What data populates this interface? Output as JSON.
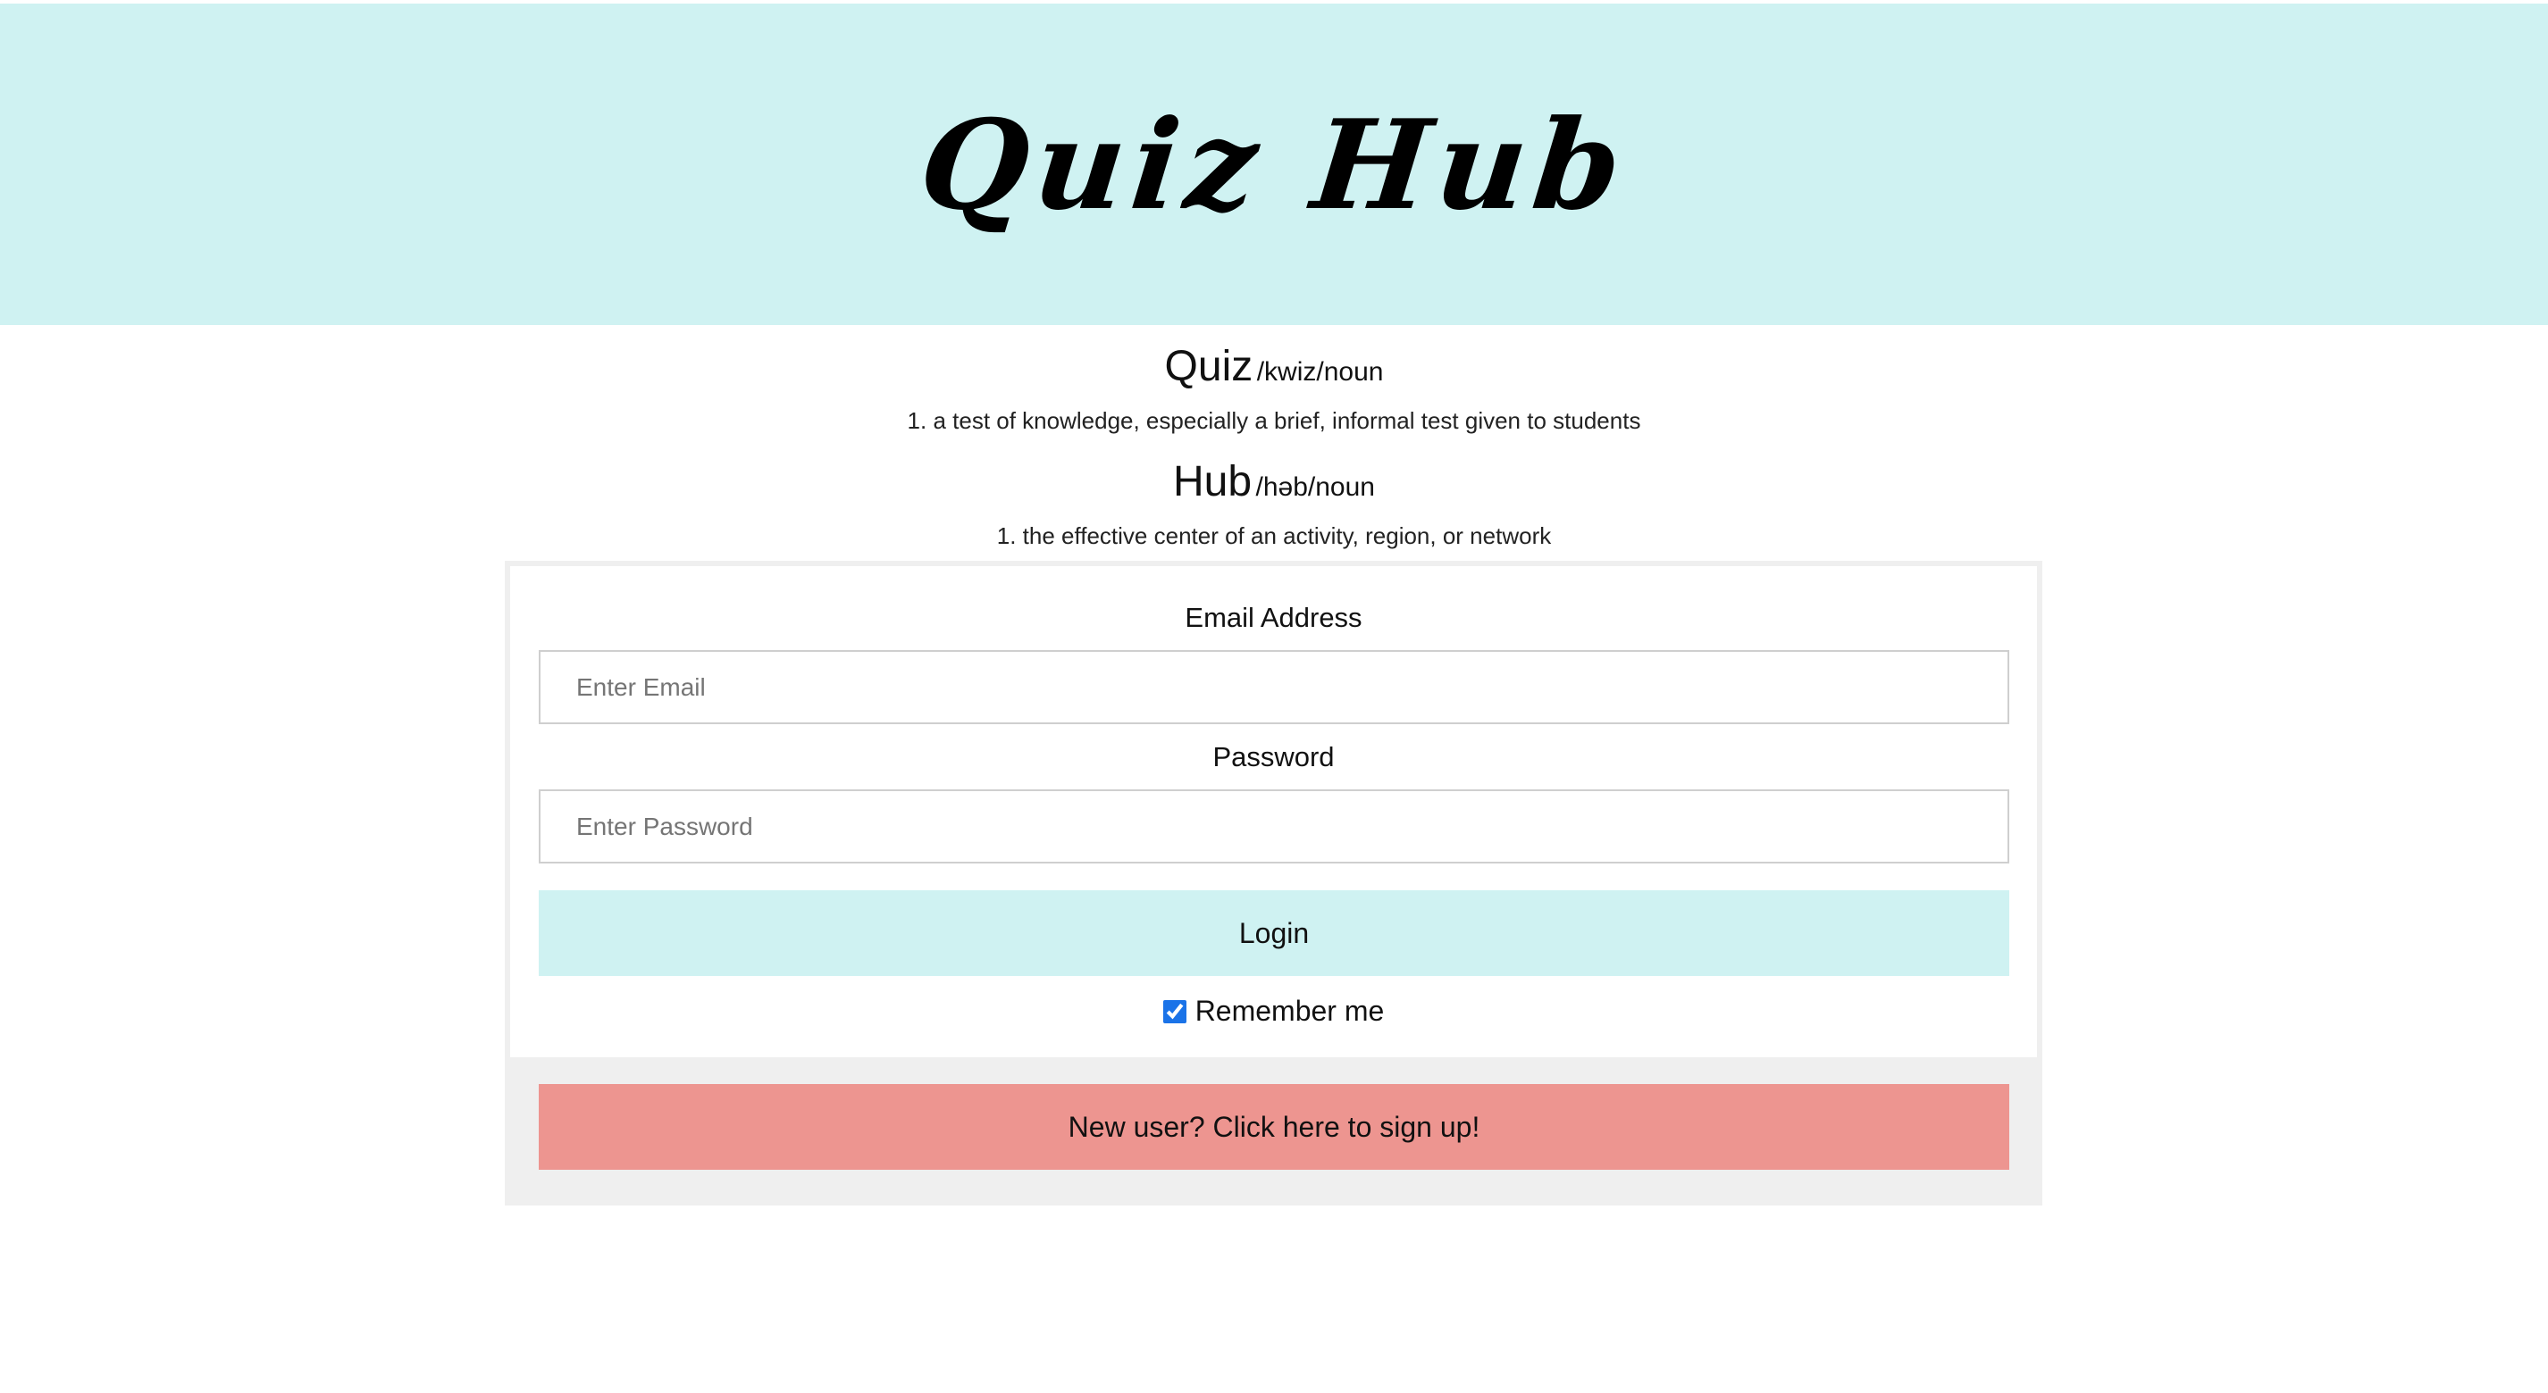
{
  "header": {
    "title": "Quiz Hub"
  },
  "definitions": [
    {
      "word": "Quiz",
      "pronunciation": "/kwiz/noun",
      "meaning": "1. a test of knowledge, especially a brief, informal test given to students"
    },
    {
      "word": "Hub",
      "pronunciation": "/həb/noun",
      "meaning": "1. the effective center of an activity, region, or network"
    }
  ],
  "login_form": {
    "email_label": "Email Address",
    "email_placeholder": "Enter Email",
    "email_value": "",
    "password_label": "Password",
    "password_placeholder": "Enter Password",
    "password_value": "",
    "login_button": "Login",
    "remember_me_label": "Remember me",
    "remember_me_checked": true,
    "signup_button": "New user? Click here to sign up!"
  },
  "colors": {
    "header_bg": "#cff2f2",
    "login_button_bg": "#cff2f2",
    "signup_button_bg": "#ed9590",
    "panel_bg": "#efefef",
    "checkbox_accent": "#1a73e8"
  }
}
